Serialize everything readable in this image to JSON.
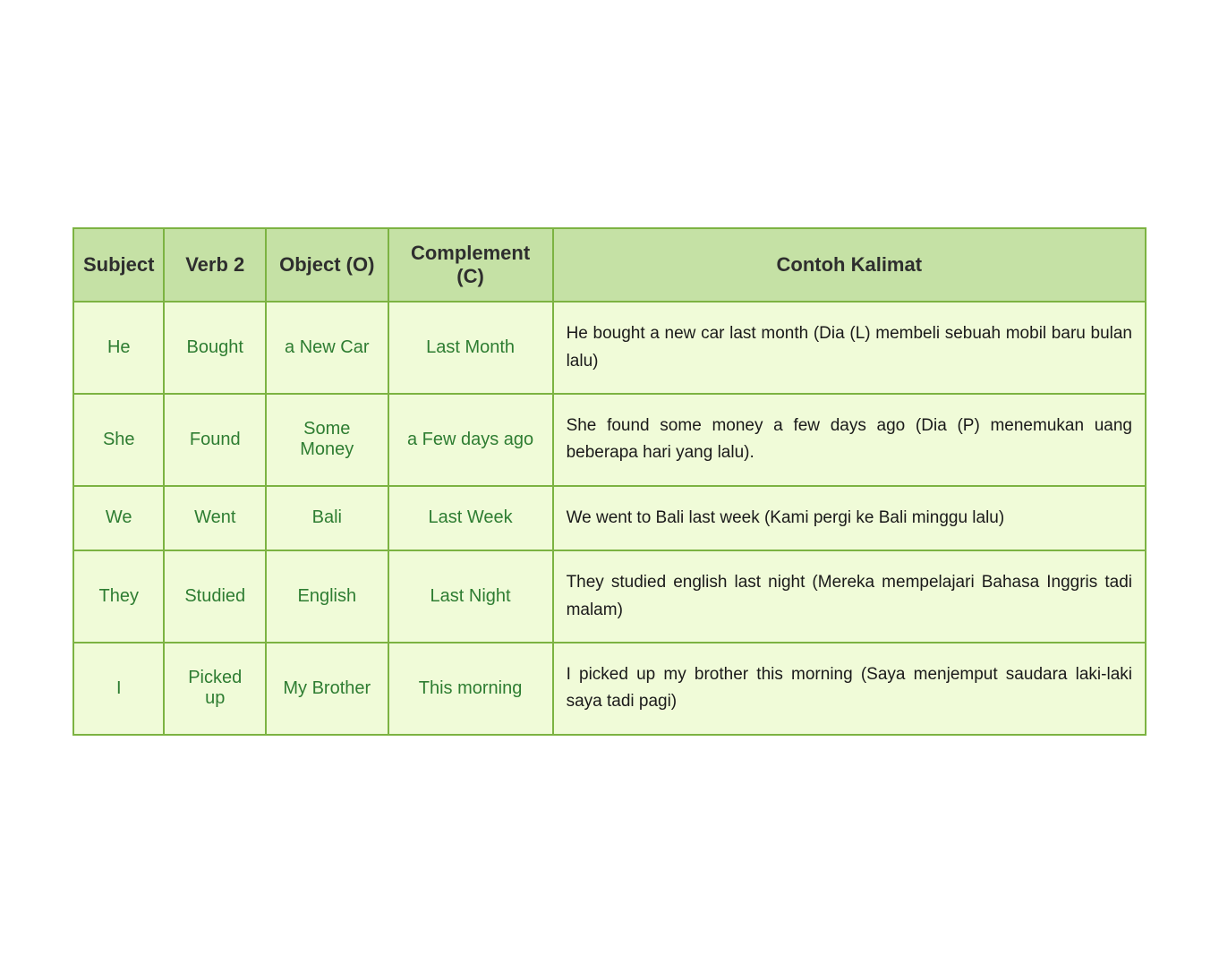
{
  "table": {
    "headers": [
      "Subject",
      "Verb 2",
      "Object (O)",
      "Complement (C)",
      "Contoh Kalimat"
    ],
    "rows": [
      {
        "subject": "He",
        "verb": "Bought",
        "object": "a New Car",
        "complement": "Last Month",
        "example": "He bought a new car last month (Dia (L) membeli sebuah mobil baru bulan lalu)"
      },
      {
        "subject": "She",
        "verb": "Found",
        "object": "Some Money",
        "complement": "a Few days ago",
        "example": "She found some money a few days ago (Dia (P) menemukan uang beberapa hari yang lalu)."
      },
      {
        "subject": "We",
        "verb": "Went",
        "object": "Bali",
        "complement": "Last Week",
        "example": "We went to Bali last week (Kami pergi ke Bali minggu lalu)"
      },
      {
        "subject": "They",
        "verb": "Studied",
        "object": "English",
        "complement": "Last Night",
        "example": "They studied english last night (Mereka mempelajari Bahasa Inggris tadi malam)"
      },
      {
        "subject": "I",
        "verb": "Picked up",
        "object": "My Brother",
        "complement": "This morning",
        "example": "I picked up my brother this morning (Saya menjemput saudara laki-laki saya tadi pagi)"
      }
    ]
  }
}
